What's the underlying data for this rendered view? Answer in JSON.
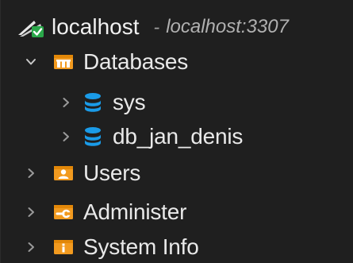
{
  "server": {
    "name": "localhost",
    "separator": "-",
    "host": "localhost:3307",
    "icon": "server-connected-icon"
  },
  "tree": {
    "databases": {
      "label": "Databases",
      "expanded": true,
      "icon": "databases-folder-icon",
      "items": [
        {
          "label": "sys",
          "icon": "database-icon"
        },
        {
          "label": "db_jan_denis",
          "icon": "database-icon"
        }
      ]
    },
    "users": {
      "label": "Users",
      "icon": "users-folder-icon"
    },
    "administer": {
      "label": "Administer",
      "icon": "administer-folder-icon"
    },
    "system_info": {
      "label": "System Info",
      "icon": "system-info-folder-icon"
    }
  },
  "colors": {
    "background": "#1f1f1f",
    "text": "#e9e9e9",
    "muted_italic": "#b0b0b0",
    "folder_orange": "#f29a1f",
    "database_blue": "#1a9be8",
    "check_green": "#2aa84a"
  }
}
